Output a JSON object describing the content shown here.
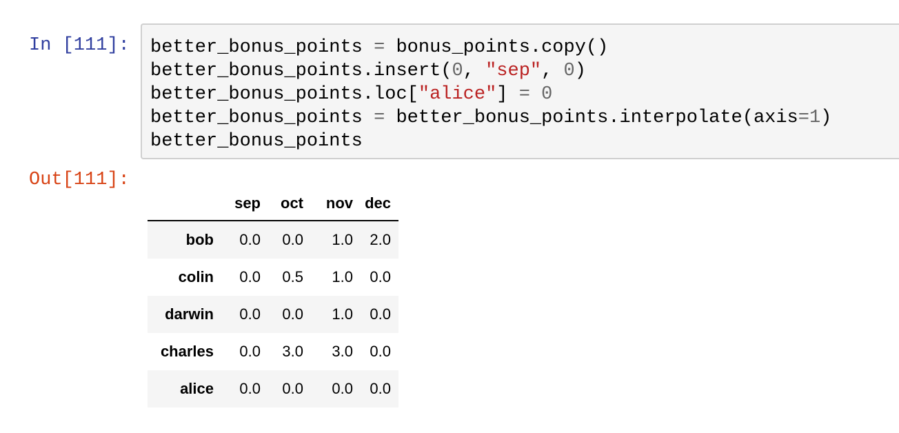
{
  "input_prompt": "In [111]:",
  "output_prompt": "Out[111]:",
  "code_lines": [
    [
      {
        "t": "better_bonus_points ",
        "c": "plain"
      },
      {
        "t": "=",
        "c": "op"
      },
      {
        "t": " bonus_points.copy()",
        "c": "plain"
      }
    ],
    [
      {
        "t": "better_bonus_points.insert(",
        "c": "plain"
      },
      {
        "t": "0",
        "c": "num"
      },
      {
        "t": ", ",
        "c": "plain"
      },
      {
        "t": "\"sep\"",
        "c": "str"
      },
      {
        "t": ", ",
        "c": "plain"
      },
      {
        "t": "0",
        "c": "num"
      },
      {
        "t": ")",
        "c": "plain"
      }
    ],
    [
      {
        "t": "better_bonus_points.loc[",
        "c": "plain"
      },
      {
        "t": "\"alice\"",
        "c": "str"
      },
      {
        "t": "] ",
        "c": "plain"
      },
      {
        "t": "=",
        "c": "op"
      },
      {
        "t": " ",
        "c": "plain"
      },
      {
        "t": "0",
        "c": "num"
      }
    ],
    [
      {
        "t": "better_bonus_points ",
        "c": "plain"
      },
      {
        "t": "=",
        "c": "op"
      },
      {
        "t": " better_bonus_points.interpolate(axis",
        "c": "plain"
      },
      {
        "t": "=",
        "c": "op"
      },
      {
        "t": "1",
        "c": "num"
      },
      {
        "t": ")",
        "c": "plain"
      }
    ],
    [
      {
        "t": "better_bonus_points",
        "c": "plain"
      }
    ]
  ],
  "table": {
    "corner": "",
    "columns": [
      "sep",
      "oct",
      "nov",
      "dec"
    ],
    "rows": [
      {
        "index": "bob",
        "values": [
          "0.0",
          "0.0",
          "1.0",
          "2.0"
        ]
      },
      {
        "index": "colin",
        "values": [
          "0.0",
          "0.5",
          "1.0",
          "0.0"
        ]
      },
      {
        "index": "darwin",
        "values": [
          "0.0",
          "0.0",
          "1.0",
          "0.0"
        ]
      },
      {
        "index": "charles",
        "values": [
          "0.0",
          "3.0",
          "3.0",
          "0.0"
        ]
      },
      {
        "index": "alice",
        "values": [
          "0.0",
          "0.0",
          "0.0",
          "0.0"
        ]
      }
    ]
  },
  "colors": {
    "input_prompt": "#303f9f",
    "output_prompt": "#d84315",
    "string": "#ba2121",
    "number": "#666666",
    "cell_background": "#f5f5f5",
    "cell_border": "#cfcfcf"
  }
}
